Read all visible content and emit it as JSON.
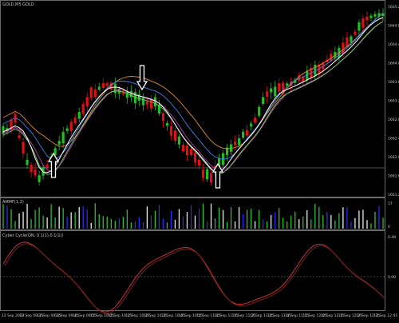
{
  "window": {
    "symbol_label": "GOLD,M5 GOLD"
  },
  "panes": {
    "volume_label": "AMMF(1,2)",
    "oscillator_label": "Cyber Cycle(ON, 0.1(1),0.1(1))"
  },
  "colors": {
    "background": "#000000",
    "grid": "#5a5a5a",
    "bull": "#1fbf1f",
    "bear": "#e01010",
    "line_white": "#ffffff",
    "line_green": "#7bd35a",
    "line_blue": "#3f7fe8",
    "line_orange": "#d98a3a",
    "line_magenta": "#d040d0",
    "osc": "#c83030",
    "vol_green": "#2fd02f",
    "vol_blue": "#3030ff",
    "vol_white": "#ffffff"
  },
  "arrows": [
    {
      "name": "up-arrow-1",
      "direction": "up"
    },
    {
      "name": "down-arrow",
      "direction": "down"
    },
    {
      "name": "up-arrow-2",
      "direction": "up"
    }
  ],
  "price_axis": [
    "1665.20",
    "1664.80",
    "1664.40",
    "1664.00",
    "1663.60",
    "1663.20",
    "1662.80",
    "1662.40",
    "1662.00",
    "1661.60",
    "1661.20"
  ],
  "volume_axis": [
    "57",
    "0"
  ],
  "osc_axis": [
    "0.48",
    "0.00"
  ],
  "time_axis": [
    "12 Sep 2013",
    "12 Sep 09:25",
    "12 Sep 09:35",
    "12 Sep 09:45",
    "12 Sep 09:55",
    "12 Sep 10:05",
    "12 Sep 10:15",
    "12 Sep 10:25",
    "12 Sep 10:35",
    "12 Sep 10:45",
    "12 Sep 10:55",
    "12 Sep 11:05",
    "12 Sep 11:15",
    "12 Sep 11:25",
    "12 Sep 11:35",
    "12 Sep 11:45",
    "12 Sep 11:55",
    "12 Sep 12:05",
    "12 Sep 12:15",
    "12 Sep 12:25",
    "12 Sep 12:35",
    "12 Sep 12:45"
  ],
  "chart_data": {
    "type": "line",
    "candles": {
      "count": 96,
      "note_series": "candles rendered as red/green OHLC bodies"
    }
  }
}
